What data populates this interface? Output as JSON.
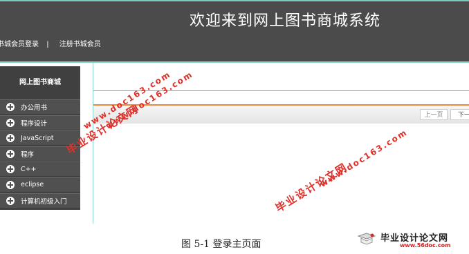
{
  "header": {
    "title": "欢迎来到网上图书商城系统",
    "nav": [
      "书城会员登录",
      "|",
      "注册书城会员"
    ],
    "bg_color": "#4b4b4b",
    "accent_color": "#8fd4cc"
  },
  "sidebar": {
    "heading": "网上图书商城",
    "categories": [
      "办公用书",
      "程序设计",
      "JavaScript",
      "程序",
      "C++",
      "eclipse",
      "计算机初级入门"
    ]
  },
  "pager": {
    "prev_label": "上一页",
    "next_label": "下一"
  },
  "caption": "图 5-1 登录主页面",
  "watermarks": {
    "site_cn": "毕业设计论文网",
    "site_url": "www.doc163.com"
  },
  "logo": {
    "text": "毕业设计论文网",
    "url": "www.56doc.com"
  }
}
